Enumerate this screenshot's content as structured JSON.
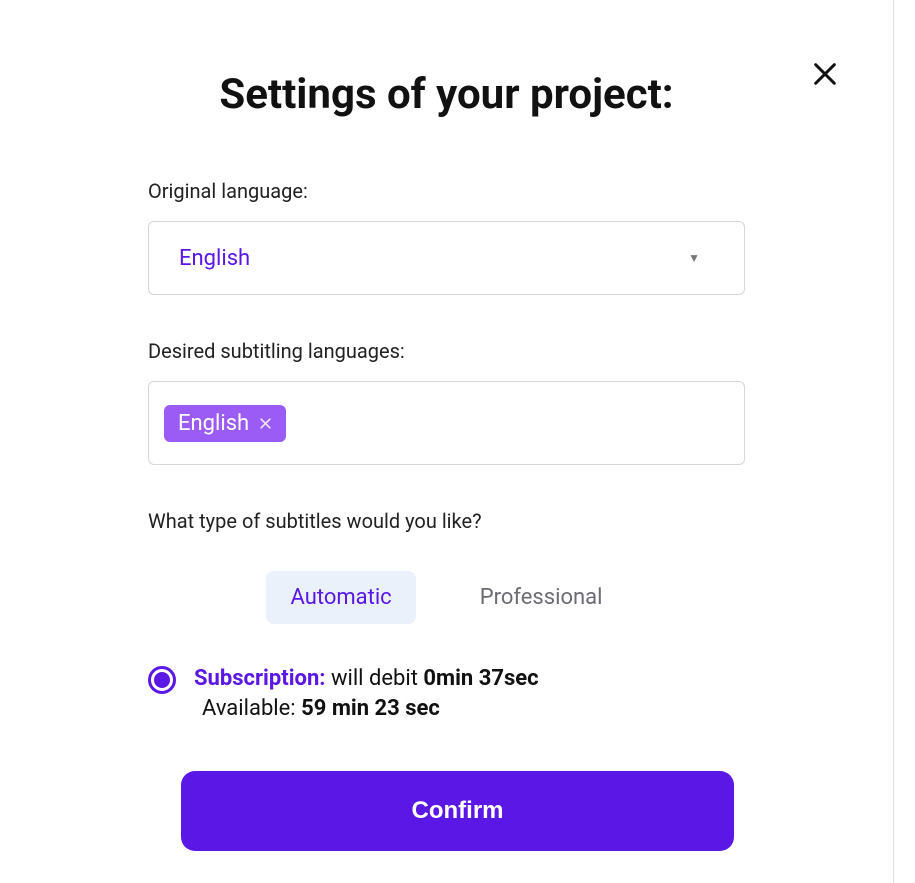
{
  "modal": {
    "title": "Settings of your project:",
    "original_language": {
      "label": "Original language:",
      "value": "English"
    },
    "desired_languages": {
      "label": "Desired subtitling languages:",
      "tags": [
        {
          "label": "English"
        }
      ]
    },
    "subtitle_type": {
      "label": "What type of subtitles would you like?",
      "options": {
        "automatic": "Automatic",
        "professional": "Professional"
      },
      "active": "automatic"
    },
    "subscription": {
      "label": "Subscription:",
      "debit_prefix": " will debit ",
      "debit_value": "0min 37sec",
      "available_prefix": "Available: ",
      "available_value": "59 min 23 sec"
    },
    "confirm_label": "Confirm"
  }
}
